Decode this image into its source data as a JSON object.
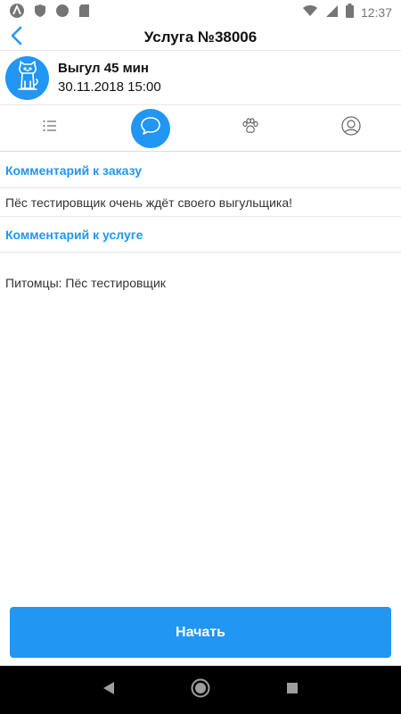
{
  "status_bar": {
    "time": "12:37",
    "icons": [
      "android-icon",
      "shield-icon",
      "circle-icon",
      "sd-card-icon",
      "wifi-icon",
      "signal-icon",
      "battery-icon"
    ]
  },
  "toolbar": {
    "title": "Услуга №38006",
    "back_icon": "chevron-left-icon"
  },
  "service": {
    "name": "Выгул 45 мин",
    "datetime": "30.11.2018 15:00",
    "avatar_icon": "dog-icon"
  },
  "tabs": [
    {
      "icon": "list-icon",
      "active": false
    },
    {
      "icon": "chat-bubble-icon",
      "active": true
    },
    {
      "icon": "paw-icon",
      "active": false
    },
    {
      "icon": "user-circle-icon",
      "active": false
    }
  ],
  "content": {
    "order_comment_title": "Комментарий к заказу",
    "order_comment_text": "Пёс тестировщик очень ждёт своего выгульщика!",
    "service_comment_title": "Комментарий к услуге",
    "pets_text": "Питомцы: Пёс тестировщик"
  },
  "actions": {
    "start_label": "Начать"
  },
  "colors": {
    "accent": "#2196F3",
    "nav_bar": "#000000"
  }
}
